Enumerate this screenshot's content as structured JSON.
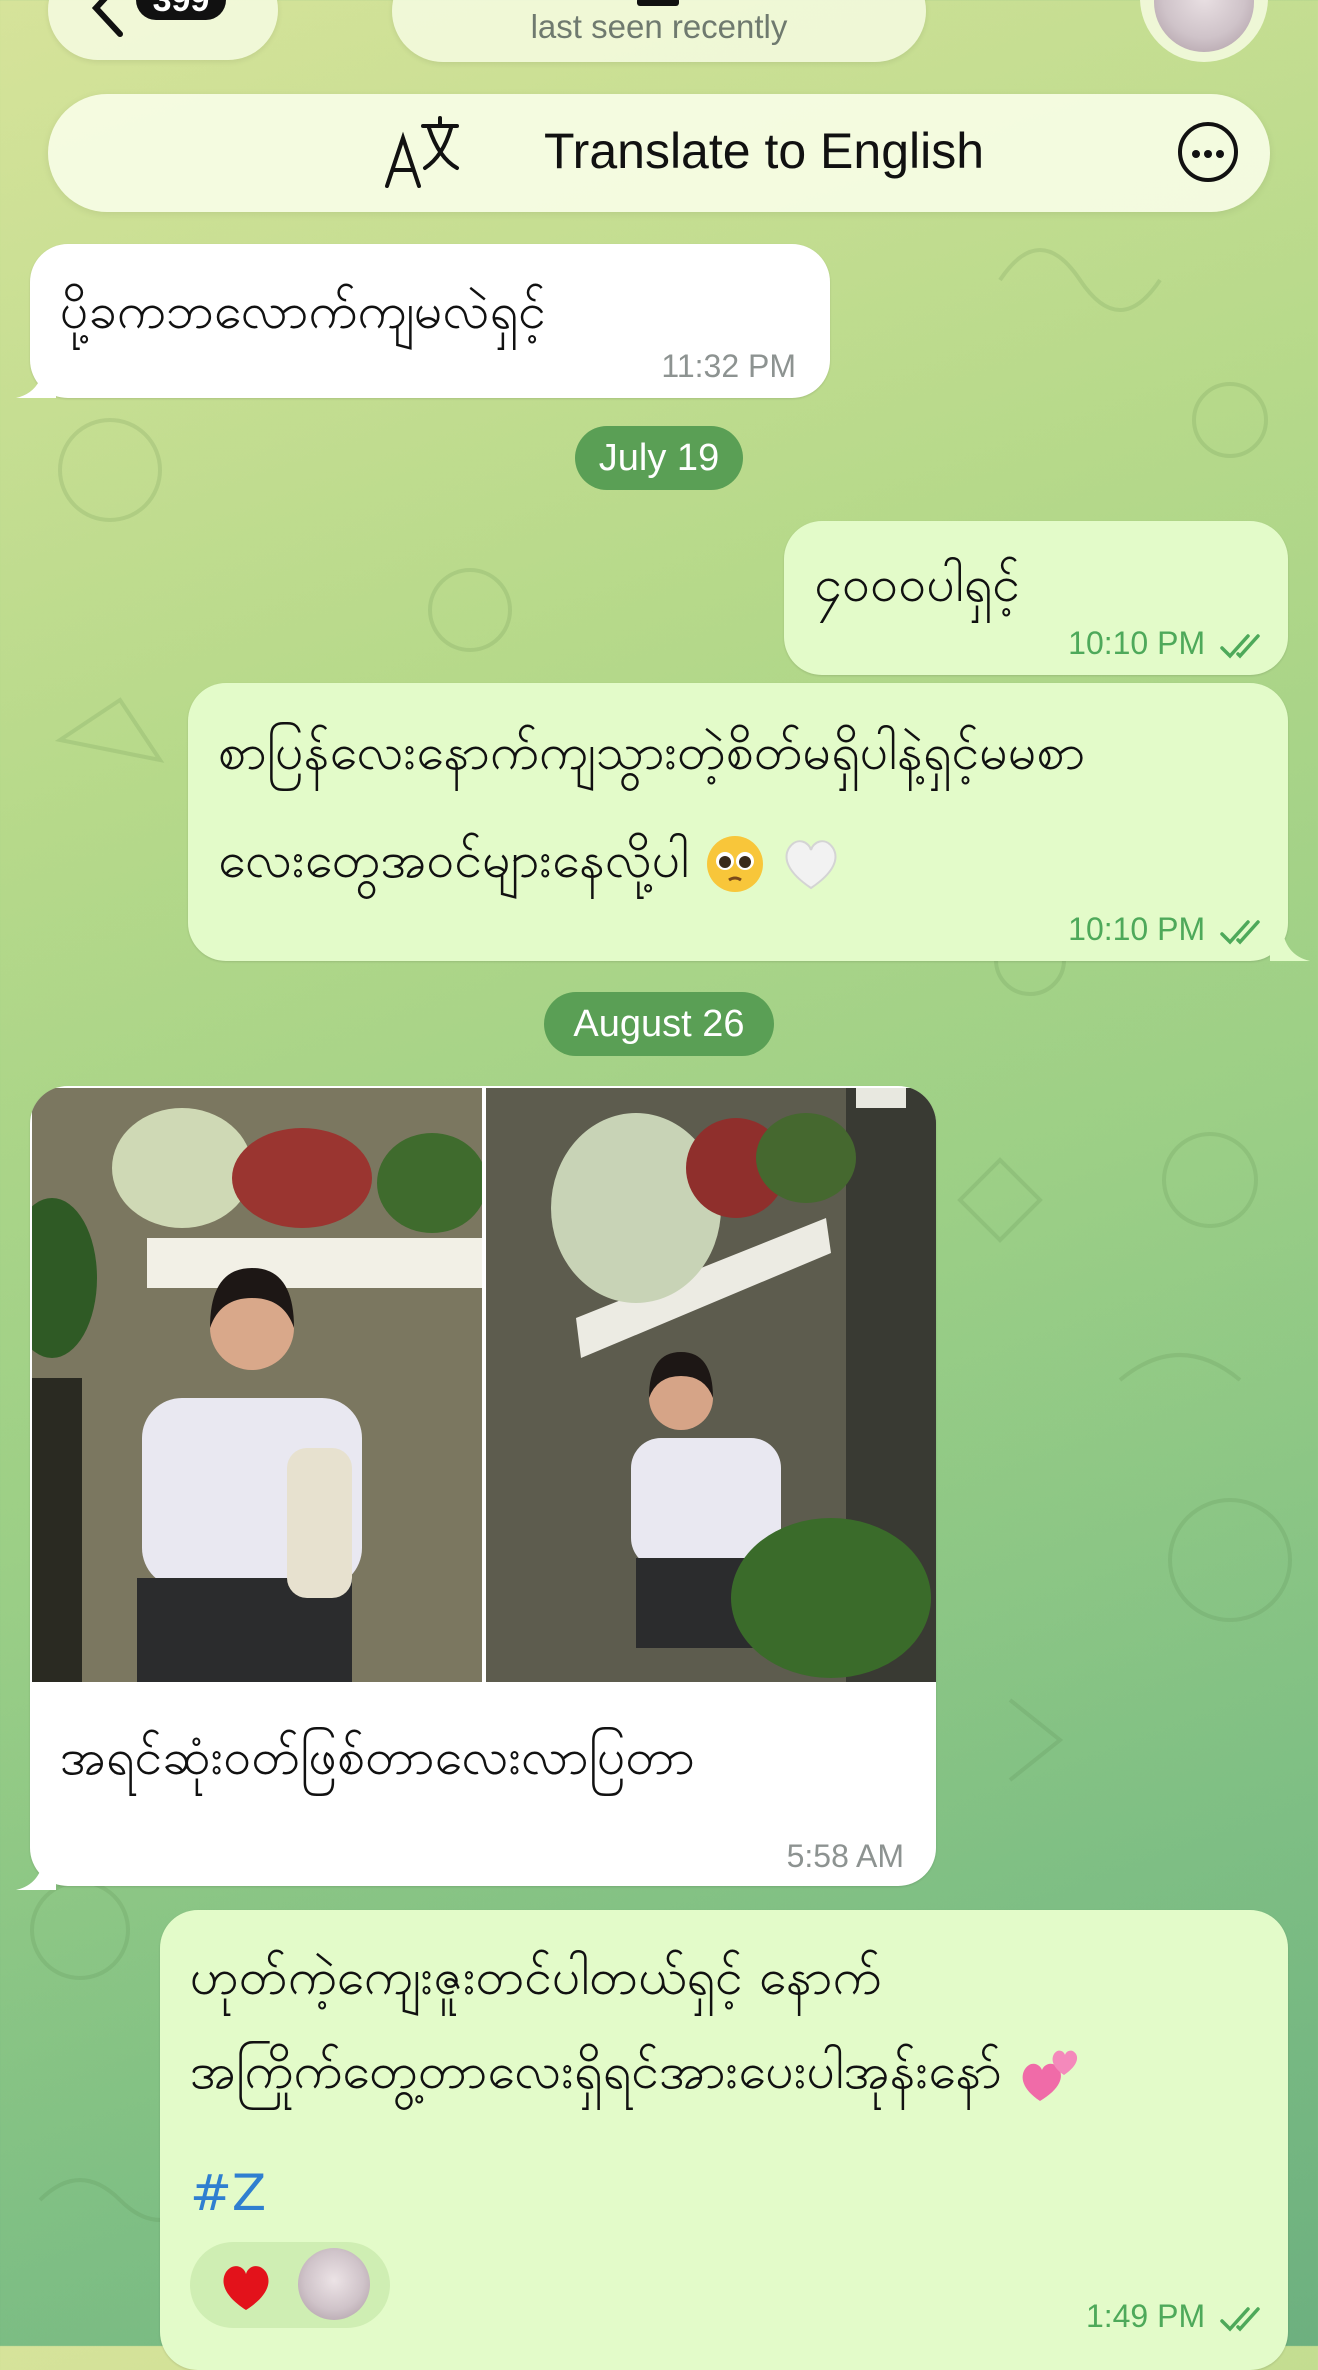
{
  "header": {
    "back_badge": "399",
    "status_text": "last seen recently"
  },
  "translate_bar": {
    "label": "Translate to English"
  },
  "messages": [
    {
      "side": "in",
      "text": "ပို့ခကဘလောက်ကျမလဲရှင့်",
      "time": "11:32 PM"
    },
    {
      "side": "out",
      "text": "၄၀၀၀ပါရှင့်",
      "time": "10:10 PM"
    },
    {
      "side": "out",
      "lines": [
        "စာပြန်လေးနောက်ကျသွားတဲ့စိတ်မရှိပါနဲ့ရှင့်မမစာ",
        "လေးတွေအဝင်များနေလို့ပါ"
      ],
      "time": "10:10 PM"
    },
    {
      "side": "in",
      "caption": "အရင်ဆုံးဝတ်ဖြစ်တာလေးလာပြတာ",
      "time": "5:58 AM"
    },
    {
      "side": "out",
      "lines": [
        "ဟုတ်ကဲ့ကျေးဇူးတင်ပါတယ်ရှင့် နောက်",
        "အကြိုက်တွေ့တာလေးရှိရင်အားပေးပါအုန်းနော်"
      ],
      "hashtag": "#Z",
      "time": "1:49 PM"
    }
  ],
  "dates": {
    "first": "July 19",
    "second": "August 26"
  },
  "icons": {
    "back": "chevron-left-icon",
    "translate": "translate-icon",
    "more": "more-circle-icon",
    "read": "double-check-icon",
    "reaction": "red-heart"
  },
  "colors": {
    "incoming_bubble": "#ffffff",
    "outgoing_bubble": "#e3fbc9",
    "outgoing_time": "#4ea95a",
    "date_pill": "#5a9f55",
    "hashtag": "#2f7fd0"
  }
}
